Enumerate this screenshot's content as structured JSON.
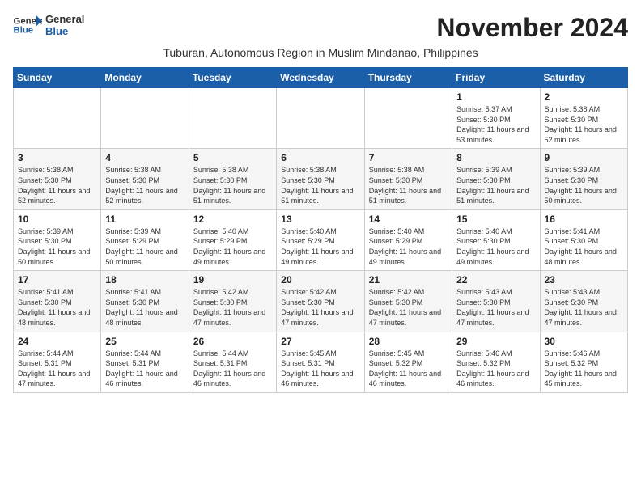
{
  "logo": {
    "line1": "General",
    "line2": "Blue"
  },
  "title": "November 2024",
  "subtitle": "Tuburan, Autonomous Region in Muslim Mindanao, Philippines",
  "days_header": [
    "Sunday",
    "Monday",
    "Tuesday",
    "Wednesday",
    "Thursday",
    "Friday",
    "Saturday"
  ],
  "weeks": [
    {
      "days": [
        {
          "num": "",
          "sunrise": "",
          "sunset": "",
          "daylight": ""
        },
        {
          "num": "",
          "sunrise": "",
          "sunset": "",
          "daylight": ""
        },
        {
          "num": "",
          "sunrise": "",
          "sunset": "",
          "daylight": ""
        },
        {
          "num": "",
          "sunrise": "",
          "sunset": "",
          "daylight": ""
        },
        {
          "num": "",
          "sunrise": "",
          "sunset": "",
          "daylight": ""
        },
        {
          "num": "1",
          "sunrise": "5:37 AM",
          "sunset": "5:30 PM",
          "daylight": "11 hours and 53 minutes."
        },
        {
          "num": "2",
          "sunrise": "5:38 AM",
          "sunset": "5:30 PM",
          "daylight": "11 hours and 52 minutes."
        }
      ]
    },
    {
      "days": [
        {
          "num": "3",
          "sunrise": "5:38 AM",
          "sunset": "5:30 PM",
          "daylight": "11 hours and 52 minutes."
        },
        {
          "num": "4",
          "sunrise": "5:38 AM",
          "sunset": "5:30 PM",
          "daylight": "11 hours and 52 minutes."
        },
        {
          "num": "5",
          "sunrise": "5:38 AM",
          "sunset": "5:30 PM",
          "daylight": "11 hours and 51 minutes."
        },
        {
          "num": "6",
          "sunrise": "5:38 AM",
          "sunset": "5:30 PM",
          "daylight": "11 hours and 51 minutes."
        },
        {
          "num": "7",
          "sunrise": "5:38 AM",
          "sunset": "5:30 PM",
          "daylight": "11 hours and 51 minutes."
        },
        {
          "num": "8",
          "sunrise": "5:39 AM",
          "sunset": "5:30 PM",
          "daylight": "11 hours and 51 minutes."
        },
        {
          "num": "9",
          "sunrise": "5:39 AM",
          "sunset": "5:30 PM",
          "daylight": "11 hours and 50 minutes."
        }
      ]
    },
    {
      "days": [
        {
          "num": "10",
          "sunrise": "5:39 AM",
          "sunset": "5:30 PM",
          "daylight": "11 hours and 50 minutes."
        },
        {
          "num": "11",
          "sunrise": "5:39 AM",
          "sunset": "5:29 PM",
          "daylight": "11 hours and 50 minutes."
        },
        {
          "num": "12",
          "sunrise": "5:40 AM",
          "sunset": "5:29 PM",
          "daylight": "11 hours and 49 minutes."
        },
        {
          "num": "13",
          "sunrise": "5:40 AM",
          "sunset": "5:29 PM",
          "daylight": "11 hours and 49 minutes."
        },
        {
          "num": "14",
          "sunrise": "5:40 AM",
          "sunset": "5:29 PM",
          "daylight": "11 hours and 49 minutes."
        },
        {
          "num": "15",
          "sunrise": "5:40 AM",
          "sunset": "5:30 PM",
          "daylight": "11 hours and 49 minutes."
        },
        {
          "num": "16",
          "sunrise": "5:41 AM",
          "sunset": "5:30 PM",
          "daylight": "11 hours and 48 minutes."
        }
      ]
    },
    {
      "days": [
        {
          "num": "17",
          "sunrise": "5:41 AM",
          "sunset": "5:30 PM",
          "daylight": "11 hours and 48 minutes."
        },
        {
          "num": "18",
          "sunrise": "5:41 AM",
          "sunset": "5:30 PM",
          "daylight": "11 hours and 48 minutes."
        },
        {
          "num": "19",
          "sunrise": "5:42 AM",
          "sunset": "5:30 PM",
          "daylight": "11 hours and 47 minutes."
        },
        {
          "num": "20",
          "sunrise": "5:42 AM",
          "sunset": "5:30 PM",
          "daylight": "11 hours and 47 minutes."
        },
        {
          "num": "21",
          "sunrise": "5:42 AM",
          "sunset": "5:30 PM",
          "daylight": "11 hours and 47 minutes."
        },
        {
          "num": "22",
          "sunrise": "5:43 AM",
          "sunset": "5:30 PM",
          "daylight": "11 hours and 47 minutes."
        },
        {
          "num": "23",
          "sunrise": "5:43 AM",
          "sunset": "5:30 PM",
          "daylight": "11 hours and 47 minutes."
        }
      ]
    },
    {
      "days": [
        {
          "num": "24",
          "sunrise": "5:44 AM",
          "sunset": "5:31 PM",
          "daylight": "11 hours and 47 minutes."
        },
        {
          "num": "25",
          "sunrise": "5:44 AM",
          "sunset": "5:31 PM",
          "daylight": "11 hours and 46 minutes."
        },
        {
          "num": "26",
          "sunrise": "5:44 AM",
          "sunset": "5:31 PM",
          "daylight": "11 hours and 46 minutes."
        },
        {
          "num": "27",
          "sunrise": "5:45 AM",
          "sunset": "5:31 PM",
          "daylight": "11 hours and 46 minutes."
        },
        {
          "num": "28",
          "sunrise": "5:45 AM",
          "sunset": "5:32 PM",
          "daylight": "11 hours and 46 minutes."
        },
        {
          "num": "29",
          "sunrise": "5:46 AM",
          "sunset": "5:32 PM",
          "daylight": "11 hours and 46 minutes."
        },
        {
          "num": "30",
          "sunrise": "5:46 AM",
          "sunset": "5:32 PM",
          "daylight": "11 hours and 45 minutes."
        }
      ]
    }
  ]
}
